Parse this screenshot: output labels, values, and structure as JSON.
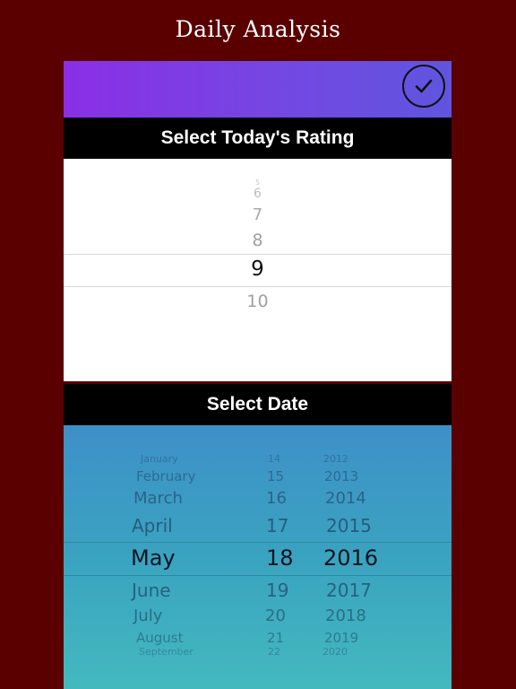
{
  "app": {
    "title": "Daily Analysis"
  },
  "rating": {
    "header": "Select Today's Rating",
    "items": [
      "5",
      "6",
      "7",
      "8",
      "9",
      "10"
    ],
    "selected": "9"
  },
  "date": {
    "header": "Select Date",
    "months": [
      "January",
      "February",
      "March",
      "April",
      "May",
      "June",
      "July",
      "August",
      "September"
    ],
    "days": [
      "14",
      "15",
      "16",
      "17",
      "18",
      "19",
      "20",
      "21",
      "22"
    ],
    "years": [
      "2012",
      "2013",
      "2014",
      "2015",
      "2016",
      "2017",
      "2018",
      "2019",
      "2020"
    ],
    "selected": {
      "month": "May",
      "day": "18",
      "year": "2016"
    }
  },
  "colors": {
    "background": "#5a0000",
    "topbar_start": "#8a2fe6",
    "topbar_end": "#5f55df",
    "header_bg": "#000000"
  },
  "icons": {
    "confirm": "checkmark-circle-icon"
  }
}
